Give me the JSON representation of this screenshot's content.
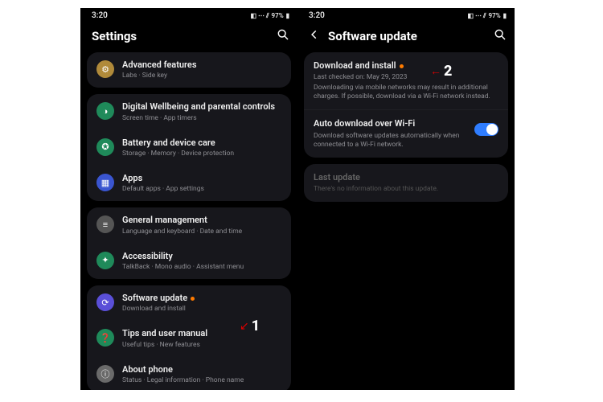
{
  "status": {
    "time": "3:20",
    "battery": "97%",
    "icons": "◧ ⋯ ⫽ ▮"
  },
  "left": {
    "title": "Settings",
    "groups": [
      [
        {
          "icon": "⚙",
          "bg": "#b08a3a",
          "title": "Advanced features",
          "sub": "Labs · Side key",
          "name": "settings-advanced-features"
        }
      ],
      [
        {
          "icon": "◑",
          "bg": "#1f8a5a",
          "title": "Digital Wellbeing and parental controls",
          "sub": "Screen time · App timers",
          "name": "settings-digital-wellbeing"
        },
        {
          "icon": "✪",
          "bg": "#1f8a5a",
          "title": "Battery and device care",
          "sub": "Storage · Memory · Device protection",
          "name": "settings-battery-care"
        },
        {
          "icon": "▦",
          "bg": "#3a55d0",
          "title": "Apps",
          "sub": "Default apps · App settings",
          "name": "settings-apps"
        }
      ],
      [
        {
          "icon": "≡",
          "bg": "#555",
          "title": "General management",
          "sub": "Language and keyboard · Date and time",
          "name": "settings-general-management"
        },
        {
          "icon": "✦",
          "bg": "#1f8a5a",
          "title": "Accessibility",
          "sub": "TalkBack · Mono audio · Assistant menu",
          "name": "settings-accessibility"
        }
      ],
      [
        {
          "icon": "⟳",
          "bg": "#5a4fd8",
          "title": "Software update",
          "sub": "Download and install",
          "name": "settings-software-update",
          "dot": true
        },
        {
          "icon": "❓",
          "bg": "#1f8a5a",
          "title": "Tips and user manual",
          "sub": "Useful tips · New features",
          "name": "settings-tips"
        },
        {
          "icon": "ⓘ",
          "bg": "#6a6a6a",
          "title": "About phone",
          "sub": "Status · Legal information · Phone name",
          "name": "settings-about-phone"
        }
      ]
    ]
  },
  "right": {
    "title": "Software update",
    "download": {
      "title": "Download and install",
      "line1": "Last checked on: May 29, 2023",
      "line2": "Downloading via mobile networks may result in additional charges. If possible, download via a Wi-Fi network instead."
    },
    "auto": {
      "title": "Auto download over Wi-Fi",
      "desc": "Download software updates automatically when connected to a Wi-Fi network.",
      "enabled": true
    },
    "last": {
      "title": "Last update",
      "desc": "There's no information about this update."
    }
  },
  "ann": {
    "one": "1",
    "two": "2"
  }
}
